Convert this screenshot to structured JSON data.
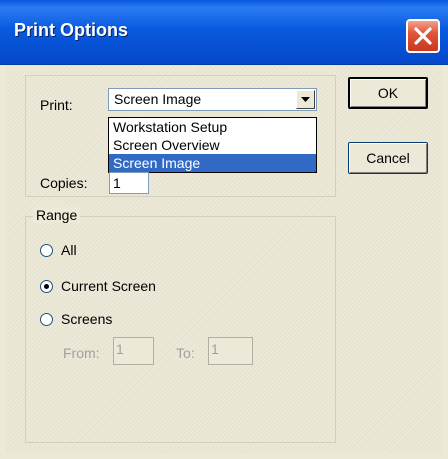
{
  "window": {
    "title": "Print Options"
  },
  "print": {
    "label": "Print:",
    "selected": "Screen Image",
    "options": [
      "Workstation Setup",
      "Screen Overview",
      "Screen Image"
    ]
  },
  "copies": {
    "label": "Copies:",
    "value": "1"
  },
  "range": {
    "legend": "Range",
    "options": [
      {
        "label": "All",
        "checked": false
      },
      {
        "label": "Current Screen",
        "checked": true
      },
      {
        "label": "Screens",
        "checked": false
      }
    ],
    "from_label": "From:",
    "from_value": "1",
    "to_label": "To:",
    "to_value": "1"
  },
  "buttons": {
    "ok": "OK",
    "cancel": "Cancel"
  }
}
